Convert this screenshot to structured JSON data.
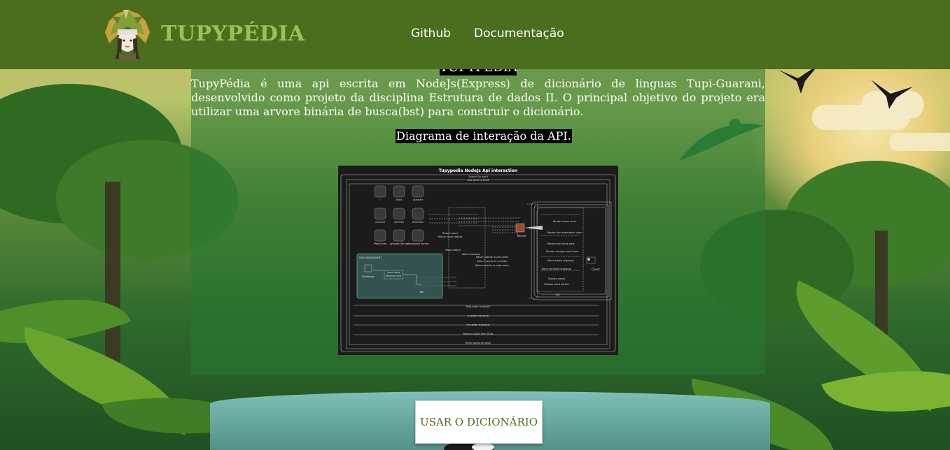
{
  "header": {
    "brand": "TUPYPÉDIA",
    "nav": {
      "github": "Github",
      "docs": "Documentação"
    }
  },
  "main": {
    "title_cut": "TUPYPÉDIA",
    "intro": "TupyPédia é uma api escrita em NodeJs(Express) de dicionário de linguas Tupi-Guarani, desenvolvido como projeto da disciplina Estrutura de dados II. O principal objetivo do projeto era utilizar uma arvore binária de busca(bst) para construir o dicionário.",
    "diagram_caption": "Diagrama de interação da API.",
    "diagram": {
      "title": "Tupypedia NodeJs Api interaction",
      "top_labels": [
        "Search for word",
        "Add word to JSON"
      ],
      "grid_buttons": [
        "/",
        "/docs",
        "/palavra",
        "/remove",
        "/inOrder",
        "/PreOrder",
        "/PostOrder",
        "activate Server",
        "deactivate Server"
      ],
      "bst_box_title": "DATA MANAGEMENT",
      "bst_labels": [
        "Dictionary",
        "Insert word",
        "Remove word",
        "BST"
      ],
      "middle_labels": [
        "Return word",
        "Return word details",
        "Word added",
        "Word removed",
        "Return words in pre-order",
        "Return words in in-order",
        "Return words in post-order"
      ],
      "server": "Server",
      "client": "Client",
      "right_labels": [
        "Render home view",
        "Render documentation view",
        "Render add word view",
        "Render remove word view",
        "Word added response",
        "Word removed response",
        "Display words",
        "Display word details",
        "GET"
      ],
      "bottom_labels": [
        "Post-order traversal",
        "In-order traversal",
        "Pre-order traversal",
        "Remove word from JSON",
        "Fetch words by letter"
      ]
    }
  },
  "cta": {
    "label": "USAR O DICIONÁRIO"
  },
  "colors": {
    "header": "#4a6e1d",
    "brand": "#9cbf5a",
    "cta_text": "#4a6e1d"
  }
}
